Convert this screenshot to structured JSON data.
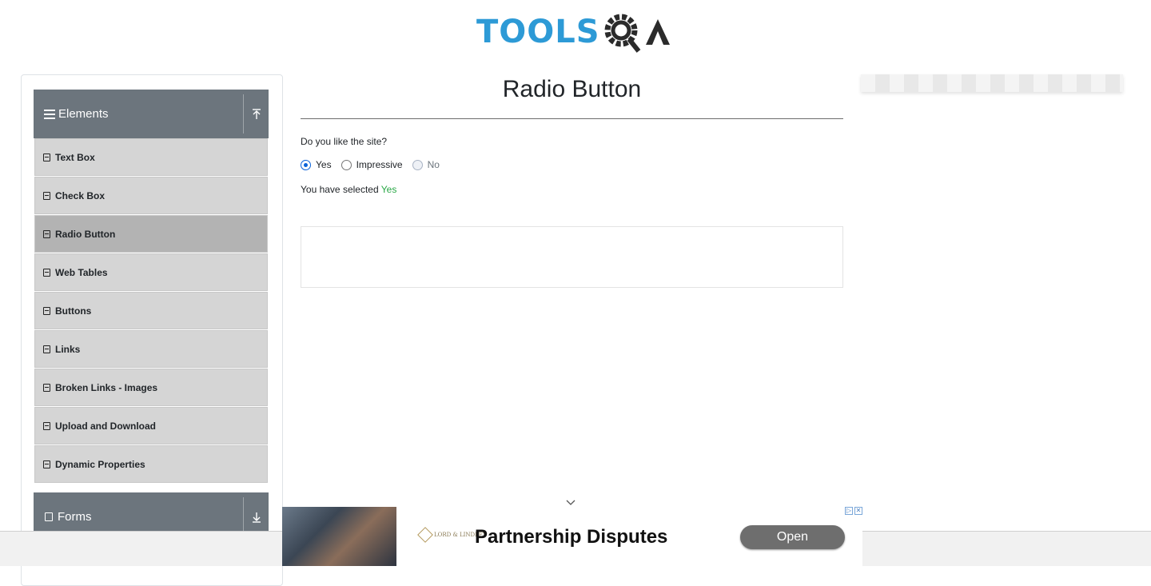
{
  "logo": {
    "tools": "TOOLS",
    "qa": "QA"
  },
  "sidebar": {
    "groups": [
      {
        "title": "Elements",
        "toggle_icon": "arrow-up-icon"
      },
      {
        "title": "Forms",
        "toggle_icon": "arrow-down-icon"
      }
    ],
    "items": [
      {
        "label": "Text Box"
      },
      {
        "label": "Check Box"
      },
      {
        "label": "Radio Button"
      },
      {
        "label": "Web Tables"
      },
      {
        "label": "Buttons"
      },
      {
        "label": "Links"
      },
      {
        "label": "Broken Links - Images"
      },
      {
        "label": "Upload and Download"
      },
      {
        "label": "Dynamic Properties"
      }
    ],
    "active_item": "Radio Button"
  },
  "main": {
    "title": "Radio Button",
    "question": "Do you like the site?",
    "options": [
      {
        "label": "Yes",
        "checked": true,
        "disabled": false
      },
      {
        "label": "Impressive",
        "checked": false,
        "disabled": false
      },
      {
        "label": "No",
        "checked": false,
        "disabled": true
      }
    ],
    "result_prefix": "You have selected",
    "result_value": "Yes"
  },
  "ad": {
    "brand": "LORD & LINDLEY",
    "headline": "Partnership Disputes",
    "cta": "Open"
  },
  "colors": {
    "sidebar_header": "#6c757d",
    "menu_item": "#d5d5d5",
    "menu_item_active": "#b3b3b3",
    "accent_green": "#28a745",
    "logo_blue": "#2d9ad6"
  }
}
